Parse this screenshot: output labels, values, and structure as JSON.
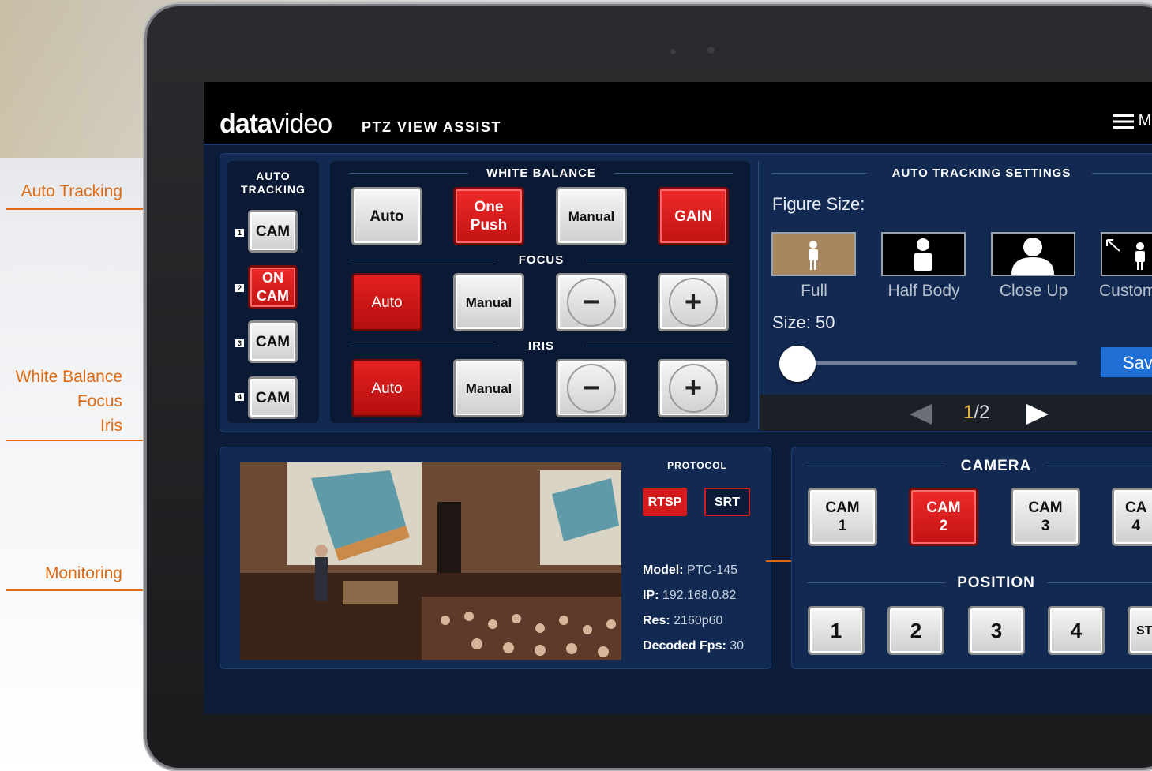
{
  "callouts": {
    "auto_tracking": "Auto Tracking",
    "wb_focus_iris": [
      "White Balance",
      "Focus",
      "Iris"
    ],
    "monitoring": "Monitoring"
  },
  "header": {
    "logo_bold": "data",
    "logo_light": "video",
    "app_title": "PTZ VIEW ASSIST",
    "menu_label": "M"
  },
  "auto_tracking": {
    "title_line1": "AUTO",
    "title_line2": "TRACKING",
    "items": [
      {
        "num": "1",
        "label": "CAM",
        "state": "off"
      },
      {
        "num": "2",
        "label": "ON\nCAM",
        "state": "on"
      },
      {
        "num": "3",
        "label": "CAM",
        "state": "off"
      },
      {
        "num": "4",
        "label": "CAM",
        "state": "off"
      }
    ]
  },
  "white_balance": {
    "title": "WHITE BALANCE",
    "buttons": [
      "Auto",
      "One\nPush",
      "Manual",
      "GAIN"
    ]
  },
  "focus": {
    "title": "FOCUS",
    "buttons": [
      "Auto",
      "Manual",
      "−",
      "+"
    ]
  },
  "iris": {
    "title": "IRIS",
    "buttons": [
      "Auto",
      "Manual",
      "−",
      "+"
    ]
  },
  "tracking_settings": {
    "title": "AUTO TRACKING SETTINGS",
    "figure_size_label": "Figure Size:",
    "figures": [
      "Full",
      "Half Body",
      "Close Up",
      "Custom"
    ],
    "selected_figure": "Full",
    "size_label": "Size: 50",
    "size_value": 50,
    "save_label": "Sav",
    "page_current": "1",
    "page_total": "/2"
  },
  "monitor": {
    "protocol_title": "PROTOCOL",
    "protocols": [
      "RTSP",
      "SRT"
    ],
    "active_protocol": "RTSP",
    "info": [
      {
        "key": "Model:",
        "value": "PTC-145"
      },
      {
        "key": "IP:",
        "value": "192.168.0.82"
      },
      {
        "key": "Res:",
        "value": "2160p60"
      },
      {
        "key": "Decoded Fps:",
        "value": "30"
      }
    ]
  },
  "camera": {
    "title": "CAMERA",
    "buttons": [
      "CAM\n1",
      "CAM\n2",
      "CAM\n3",
      "CA\n4"
    ],
    "active": "CAM 2"
  },
  "position": {
    "title": "POSITION",
    "buttons": [
      "1",
      "2",
      "3",
      "4",
      "ST"
    ]
  },
  "colors": {
    "accent": "#e06a12",
    "red": "#d41a1a",
    "panel": "#122a52",
    "save_blue": "#1f6fd6"
  }
}
